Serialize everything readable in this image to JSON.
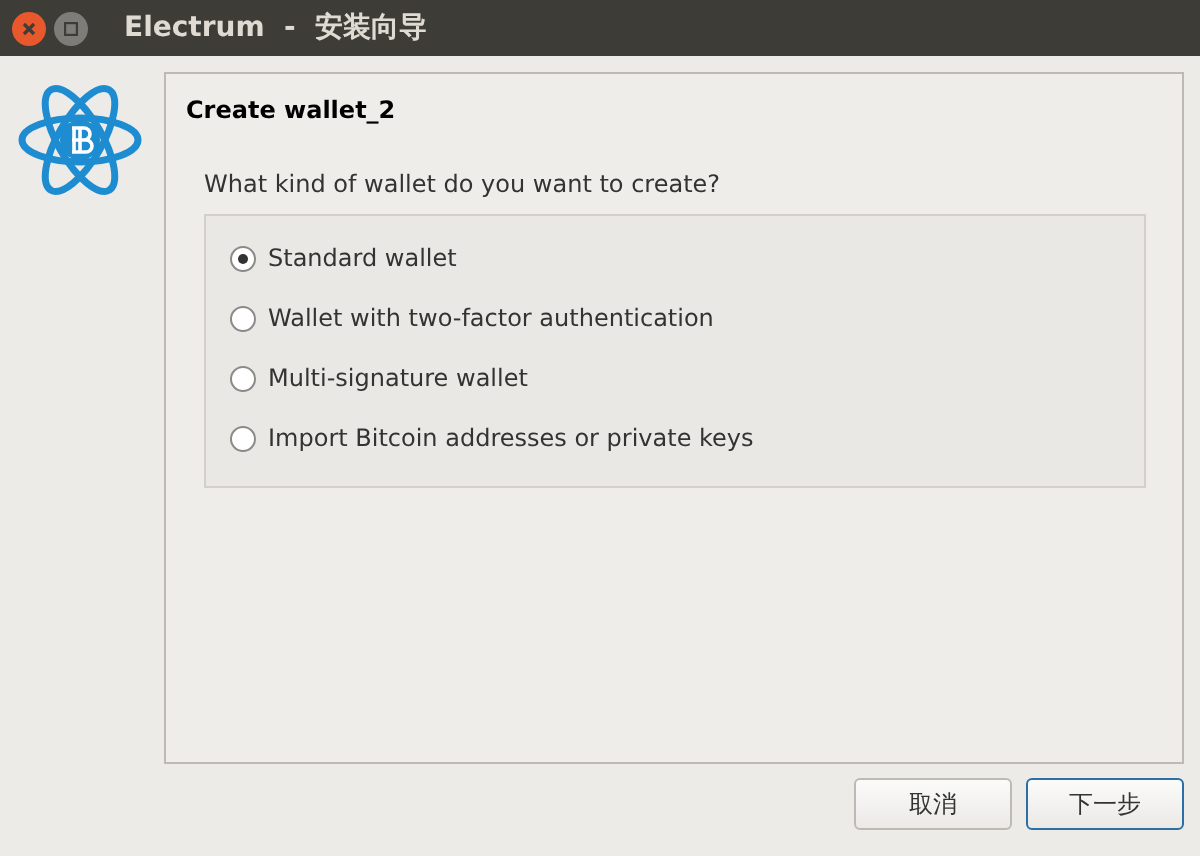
{
  "window": {
    "title": "Electrum  -  安装向导"
  },
  "page": {
    "title": "Create wallet_2",
    "question": "What kind of wallet do you want to create?"
  },
  "options": [
    {
      "label": "Standard wallet",
      "selected": true
    },
    {
      "label": "Wallet with two-factor authentication",
      "selected": false
    },
    {
      "label": "Multi-signature wallet",
      "selected": false
    },
    {
      "label": "Import Bitcoin addresses or private keys",
      "selected": false
    }
  ],
  "buttons": [
    {
      "label": "取消",
      "kind": "normal"
    },
    {
      "label": "下一步",
      "kind": "default"
    }
  ]
}
